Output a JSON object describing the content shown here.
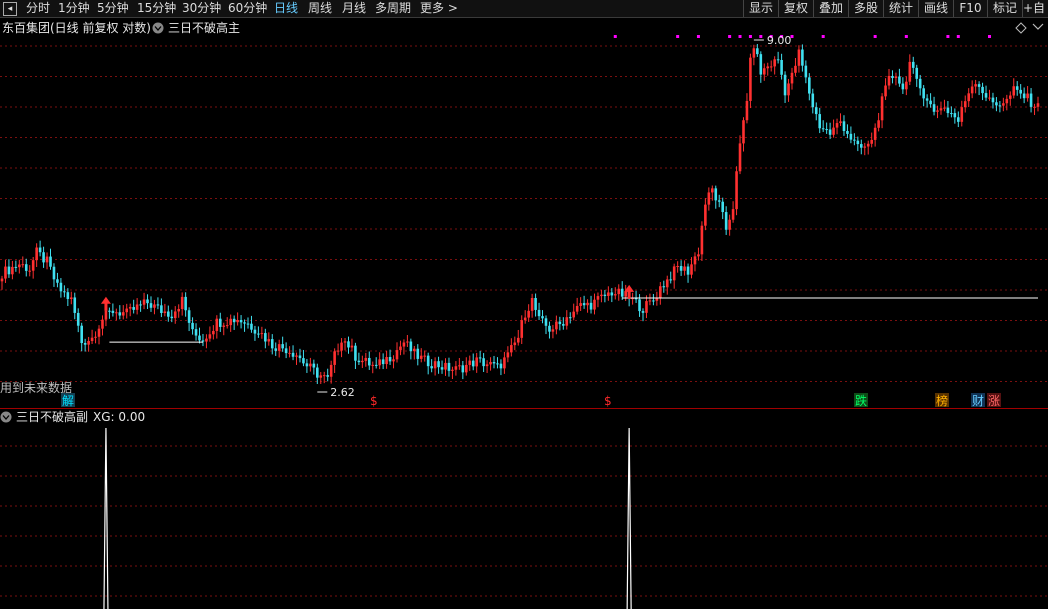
{
  "toolbar": {
    "back_icon": "square-back-icon",
    "periods": [
      "分时",
      "1分钟",
      "5分钟",
      "15分钟",
      "30分钟",
      "60分钟",
      "日线",
      "周线",
      "月线",
      "多周期",
      "更多 >"
    ],
    "active_period": "日线",
    "right_buttons": [
      "显示",
      "复权",
      "叠加",
      "多股",
      "统计",
      "画线",
      "F10",
      "标记",
      "+自选"
    ]
  },
  "main_panel": {
    "title": "东百集团(日线 前复权 对数)",
    "indicator_name": "三日不破高主",
    "future_data_note": "用到未来数据",
    "max_label": "9.00",
    "min_label": "2.62",
    "marker_labels": [
      {
        "text": "解",
        "color": "#00e0ff",
        "bg": "#133f52"
      },
      {
        "text": "$",
        "color": "#ff2a2a",
        "bg": ""
      },
      {
        "text": "$",
        "color": "#ff2a2a",
        "bg": ""
      },
      {
        "text": "跌",
        "color": "#00ff66",
        "bg": "#0f4d18"
      },
      {
        "text": "榜",
        "color": "#ffb000",
        "bg": "#5a3300"
      },
      {
        "text": "财",
        "color": "#66ccff",
        "bg": "#113355"
      },
      {
        "text": "涨",
        "color": "#ff6666",
        "bg": "#551111"
      }
    ]
  },
  "sub_panel": {
    "title": "三日不破高副",
    "value_label": "XG: 0.00"
  },
  "colors": {
    "up": "#ff3030",
    "down": "#40e0f0",
    "grid": "#7a1010",
    "divider": "#a00000",
    "magenta": "#ff00ff",
    "white": "#ffffff"
  },
  "chart_data": {
    "type": "candlestick",
    "scale": "log",
    "price_range": [
      2.62,
      9.0
    ],
    "close_path": [
      [
        0,
        3.92
      ],
      [
        5,
        4.05
      ],
      [
        8,
        3.98
      ],
      [
        10,
        4.22
      ],
      [
        13,
        4.08
      ],
      [
        16,
        3.72
      ],
      [
        20,
        3.55
      ],
      [
        23,
        3.05
      ],
      [
        26,
        3.1
      ],
      [
        29,
        3.32
      ],
      [
        32,
        3.42
      ],
      [
        36,
        3.38
      ],
      [
        39,
        3.46
      ],
      [
        42,
        3.52
      ],
      [
        46,
        3.42
      ],
      [
        49,
        3.38
      ],
      [
        52,
        3.55
      ],
      [
        55,
        3.15
      ],
      [
        58,
        3.08
      ],
      [
        62,
        3.28
      ],
      [
        65,
        3.3
      ],
      [
        68,
        3.32
      ],
      [
        71,
        3.26
      ],
      [
        74,
        3.18
      ],
      [
        78,
        3.02
      ],
      [
        82,
        2.98
      ],
      [
        85,
        2.92
      ],
      [
        88,
        2.8
      ],
      [
        91,
        2.72
      ],
      [
        94,
        2.66
      ],
      [
        96,
        2.9
      ],
      [
        98,
        3.1
      ],
      [
        100,
        3.02
      ],
      [
        102,
        2.9
      ],
      [
        104,
        2.85
      ],
      [
        106,
        2.82
      ],
      [
        108,
        2.78
      ],
      [
        110,
        2.85
      ],
      [
        113,
        2.92
      ],
      [
        116,
        3.05
      ],
      [
        119,
        2.92
      ],
      [
        122,
        2.85
      ],
      [
        125,
        2.82
      ],
      [
        128,
        2.78
      ],
      [
        131,
        2.76
      ],
      [
        134,
        2.8
      ],
      [
        137,
        2.85
      ],
      [
        140,
        2.82
      ],
      [
        143,
        2.78
      ],
      [
        146,
        2.9
      ],
      [
        149,
        3.1
      ],
      [
        151,
        3.4
      ],
      [
        153,
        3.55
      ],
      [
        155,
        3.3
      ],
      [
        158,
        3.2
      ],
      [
        161,
        3.25
      ],
      [
        164,
        3.38
      ],
      [
        167,
        3.48
      ],
      [
        170,
        3.5
      ],
      [
        173,
        3.58
      ],
      [
        176,
        3.66
      ],
      [
        179,
        3.62
      ],
      [
        182,
        3.55
      ],
      [
        185,
        3.45
      ],
      [
        188,
        3.55
      ],
      [
        190,
        3.72
      ],
      [
        192,
        3.82
      ],
      [
        195,
        4.0
      ],
      [
        198,
        3.95
      ],
      [
        201,
        4.25
      ],
      [
        203,
        5.05
      ],
      [
        205,
        5.3
      ],
      [
        207,
        5.0
      ],
      [
        209,
        4.6
      ],
      [
        211,
        5.0
      ],
      [
        213,
        6.2
      ],
      [
        215,
        7.4
      ],
      [
        216,
        8.4
      ],
      [
        217,
        9.0
      ],
      [
        219,
        8.1
      ],
      [
        221,
        8.3
      ],
      [
        224,
        8.5
      ],
      [
        226,
        7.6
      ],
      [
        228,
        8.0
      ],
      [
        230,
        8.7
      ],
      [
        232,
        7.9
      ],
      [
        234,
        7.2
      ],
      [
        236,
        6.7
      ],
      [
        239,
        6.5
      ],
      [
        242,
        6.8
      ],
      [
        245,
        6.4
      ],
      [
        247,
        6.15
      ],
      [
        250,
        6.2
      ],
      [
        252,
        6.6
      ],
      [
        254,
        7.3
      ],
      [
        256,
        7.9
      ],
      [
        258,
        8.1
      ],
      [
        260,
        7.6
      ],
      [
        262,
        8.4
      ],
      [
        264,
        7.8
      ],
      [
        267,
        7.4
      ],
      [
        269,
        7.0
      ],
      [
        271,
        7.2
      ],
      [
        274,
        7.0
      ],
      [
        276,
        6.8
      ],
      [
        279,
        7.6
      ],
      [
        281,
        7.9
      ],
      [
        283,
        7.6
      ],
      [
        285,
        7.3
      ],
      [
        287,
        7.25
      ],
      [
        290,
        7.32
      ],
      [
        292,
        7.6
      ],
      [
        295,
        7.45
      ],
      [
        297,
        7.3
      ],
      [
        299,
        7.15
      ]
    ],
    "num_bars": 300,
    "support_lines": [
      {
        "from_bar": 31,
        "to_bar": 58,
        "price": 3.05
      },
      {
        "from_bar": 179,
        "to_bar": 299,
        "price": 3.58
      }
    ],
    "buy_arrows": [
      {
        "bar": 30
      },
      {
        "bar": 181
      }
    ],
    "future_markers_top": "magenta dots above bars (approx. bar 177-299)",
    "sub_indicator": {
      "name": "XG",
      "current_value": 0.0,
      "signals": [
        {
          "bar": 30,
          "value": 1
        },
        {
          "bar": 181,
          "value": 1
        }
      ]
    }
  }
}
